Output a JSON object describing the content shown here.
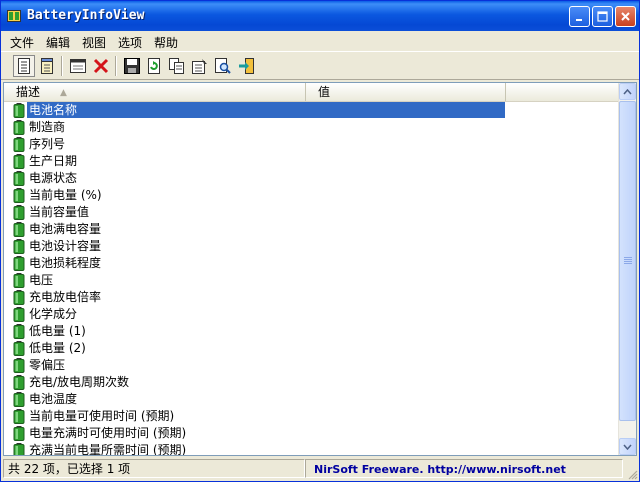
{
  "window": {
    "title": "BatteryInfoView"
  },
  "menu": [
    "文件",
    "编辑",
    "视图",
    "选项",
    "帮助"
  ],
  "toolbar": {
    "buttons": [
      {
        "name": "battery-info-view-button",
        "icon": "document-list-icon"
      },
      {
        "name": "log-view-button",
        "icon": "notepad-icon"
      },
      {
        "name": "properties-window-button",
        "icon": "window-icon"
      },
      {
        "name": "delete-button",
        "icon": "red-x-icon"
      },
      {
        "name": "save-button",
        "icon": "floppy-disk-icon"
      },
      {
        "name": "refresh-button",
        "icon": "green-refresh-icon"
      },
      {
        "name": "copy-button",
        "icon": "copy-icon"
      },
      {
        "name": "properties-button",
        "icon": "properties-icon"
      },
      {
        "name": "find-button",
        "icon": "find-icon"
      },
      {
        "name": "exit-button",
        "icon": "exit-door-icon"
      }
    ]
  },
  "list": {
    "columns": [
      "描述",
      "值"
    ],
    "sort_indicator": "▲",
    "rows": [
      "电池名称",
      "制造商",
      "序列号",
      "生产日期",
      "电源状态",
      "当前电量 (%)",
      "当前容量值",
      "电池满电容量",
      "电池设计容量",
      "电池损耗程度",
      "电压",
      "充电放电倍率",
      "化学成分",
      "低电量 (1)",
      "低电量 (2)",
      "零偏压",
      "充电/放电周期次数",
      "电池温度",
      "当前电量可使用时间 (预期)",
      "电量充满时可使用时间 (预期)",
      "充满当前电量所需时间 (预期)"
    ],
    "selected_index": 0
  },
  "status": {
    "count": "共 22 项，已选择 1 项",
    "credit": "NirSoft Freeware.  http://www.nirsoft.net"
  },
  "colors": {
    "titlebar": "#0b58e0",
    "selection": "#316ac5",
    "battery_icon": "#2e9e2e"
  }
}
